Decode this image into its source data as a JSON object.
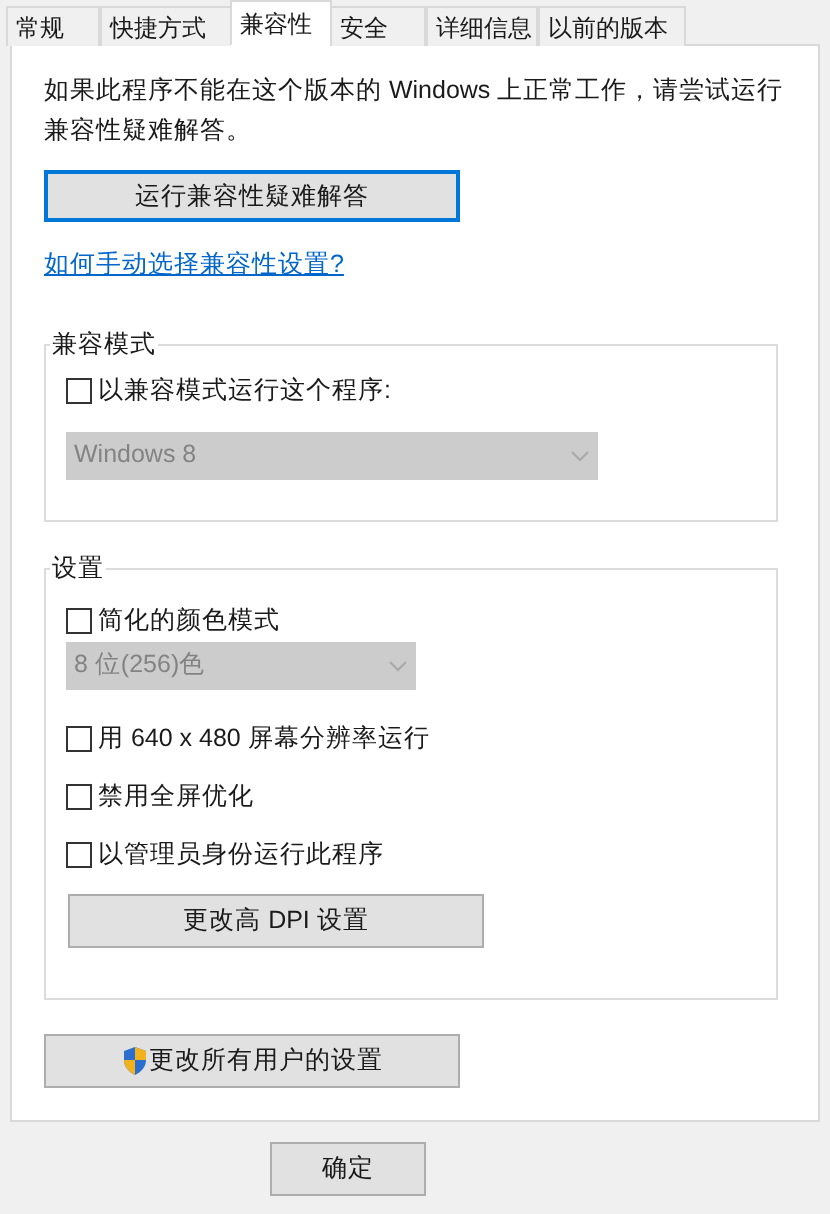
{
  "tabs": [
    {
      "label": "常规",
      "selected": false
    },
    {
      "label": "快捷方式",
      "selected": false
    },
    {
      "label": "兼容性",
      "selected": true
    },
    {
      "label": "安全",
      "selected": false
    },
    {
      "label": "详细信息",
      "selected": false
    },
    {
      "label": "以前的版本",
      "selected": false
    }
  ],
  "description": "如果此程序不能在这个版本的 Windows 上正常工作，请尝试运行兼容性疑难解答。",
  "troubleshoot_button": {
    "label": "运行兼容性疑难解答",
    "focused": true
  },
  "help_link": "如何手动选择兼容性设置?",
  "compat_group": {
    "title": "兼容模式",
    "checkbox": {
      "label": "以兼容模式运行这个程序:",
      "checked": false
    },
    "dropdown": {
      "value": "Windows 8",
      "disabled": true
    }
  },
  "settings_group": {
    "title": "设置",
    "items": [
      {
        "kind": "checkbox",
        "label": "简化的颜色模式",
        "checked": false
      },
      {
        "kind": "dropdown",
        "value": "8 位(256)色",
        "disabled": true
      },
      {
        "kind": "checkbox",
        "label": "用 640 x 480 屏幕分辨率运行",
        "checked": false
      },
      {
        "kind": "checkbox",
        "label": "禁用全屏优化",
        "checked": false
      },
      {
        "kind": "checkbox",
        "label": "以管理员身份运行此程序",
        "checked": false
      },
      {
        "kind": "button",
        "label": "更改高 DPI 设置"
      }
    ]
  },
  "all_users_button": {
    "label": "更改所有用户的设置"
  },
  "buttons": [
    "确定"
  ]
}
